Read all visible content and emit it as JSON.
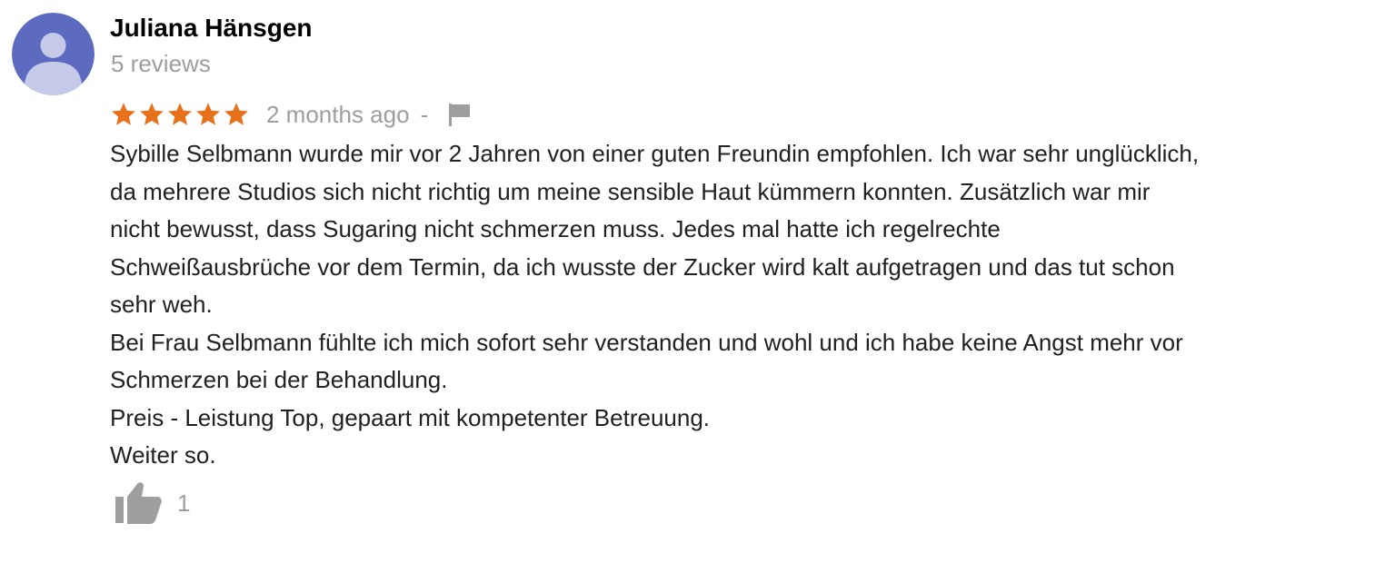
{
  "review": {
    "author_name": "Juliana Hänsgen",
    "review_count": "5 reviews",
    "rating": 5,
    "rating_max": 5,
    "time_ago": "2 months ago",
    "separator": "-",
    "text_lines": [
      "Sybille Selbmann wurde mir vor 2 Jahren von einer guten Freundin empfohlen. Ich war sehr unglücklich,",
      "da mehrere Studios sich nicht richtig um meine sensible Haut kümmern konnten. Zusätzlich war mir",
      "nicht bewusst, dass Sugaring nicht schmerzen muss. Jedes mal hatte ich regelrechte",
      "Schweißausbrüche vor dem Termin, da ich wusste der Zucker wird kalt aufgetragen und das tut schon",
      "sehr weh.",
      "Bei Frau Selbmann fühlte ich mich sofort sehr verstanden und wohl und ich habe keine Angst mehr vor",
      "Schmerzen bei der Behandlung.",
      "Preis - Leistung Top, gepaart mit kompetenter Betreuung.",
      "Weiter so."
    ],
    "like_count": "1"
  },
  "icons": {
    "avatar": "person-silhouette-icon",
    "star": "star-icon",
    "flag": "flag-icon",
    "like": "thumbs-up-icon"
  },
  "colors": {
    "star": "#e7711b",
    "avatar_background": "#5c6bc0",
    "avatar_person": "#c5cae9",
    "muted_text": "#9e9e9e",
    "icon_gray": "#9e9e9e",
    "name_text": "#000000",
    "body_text": "#202124"
  }
}
